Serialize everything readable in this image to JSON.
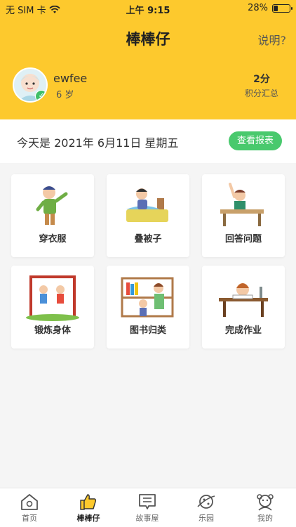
{
  "status_bar": {
    "carrier": "无 SIM 卡",
    "time": "上午 9:15",
    "battery": "28%",
    "battery_level": 0.28
  },
  "header": {
    "title": "棒棒仔",
    "help_label": "说明?"
  },
  "profile": {
    "name": "ewfee",
    "age": "6 岁",
    "points": "2分",
    "points_label": "积分汇总"
  },
  "date_bar": {
    "date_text": "今天是 2021年 6月11日  星期五",
    "report_button": "查看报表"
  },
  "tasks": [
    {
      "label": "穿衣服",
      "icon": "dressing-icon"
    },
    {
      "label": "叠被子",
      "icon": "fold-quilt-icon"
    },
    {
      "label": "回答问题",
      "icon": "answer-question-icon"
    },
    {
      "label": "锻炼身体",
      "icon": "exercise-icon"
    },
    {
      "label": "图书归类",
      "icon": "sort-books-icon"
    },
    {
      "label": "完成作业",
      "icon": "homework-icon"
    }
  ],
  "tabbar": {
    "items": [
      {
        "label": "首页",
        "icon": "home-icon"
      },
      {
        "label": "棒棒仔",
        "icon": "thumbs-up-icon"
      },
      {
        "label": "故事屋",
        "icon": "story-icon"
      },
      {
        "label": "乐园",
        "icon": "planet-icon"
      },
      {
        "label": "我的",
        "icon": "profile-icon"
      }
    ],
    "active": "棒棒仔"
  },
  "colors": {
    "header_bg": "#fdc92d",
    "report_button": "#49c96d",
    "page_bg": "#f5f5f5"
  }
}
